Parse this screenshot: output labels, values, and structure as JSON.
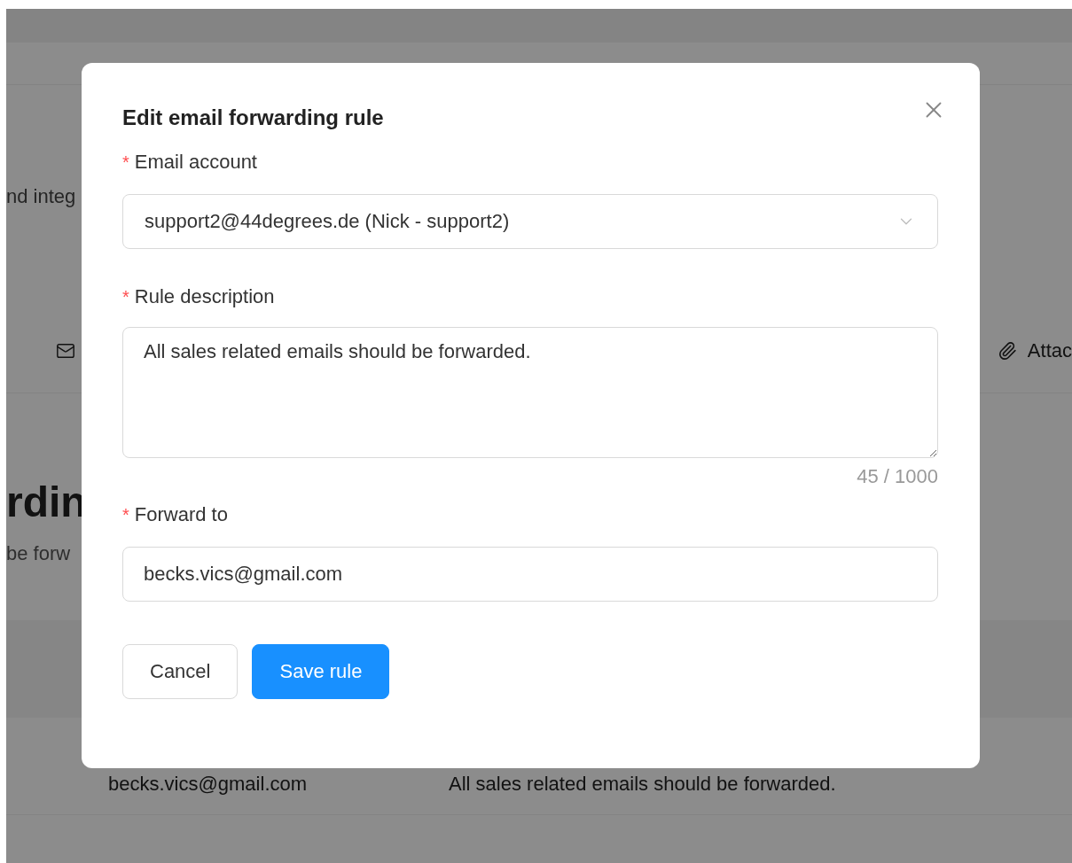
{
  "background": {
    "intro_fragment": "nd integ",
    "toolbar": {
      "attachment_fragment": "Attac"
    },
    "heading_fragment": "rdin",
    "subtitle_fragment": "be forw",
    "table": {
      "rows": [
        {
          "forward_to": "becks.vics@gmail.com",
          "description": "All sales related emails should be forwarded."
        }
      ]
    }
  },
  "dialog": {
    "title": "Edit email forwarding rule",
    "fields": [
      {
        "kind": "select",
        "label": "Email account",
        "marker": "*",
        "value": "support2@44degrees.de (Nick - support2)"
      },
      {
        "kind": "textarea",
        "label": "Rule description",
        "marker": "*",
        "value": "All sales related emails should be forwarded.",
        "counter": "45 / 1000"
      },
      {
        "kind": "input",
        "label": "Forward to",
        "marker": "*",
        "value": "becks.vics@gmail.com"
      }
    ],
    "buttons": [
      {
        "label": "Cancel",
        "kind": "default"
      },
      {
        "label": "Save rule",
        "kind": "primary"
      }
    ]
  }
}
